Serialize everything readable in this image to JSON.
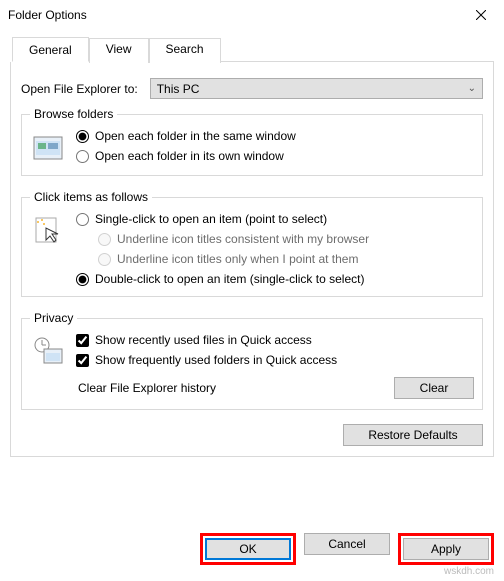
{
  "title": "Folder Options",
  "tabs": {
    "general": "General",
    "view": "View",
    "search": "Search"
  },
  "openExplorer": {
    "label": "Open File Explorer to:",
    "value": "This PC"
  },
  "browse": {
    "legend": "Browse folders",
    "same": "Open each folder in the same window",
    "own": "Open each folder in its own window"
  },
  "click": {
    "legend": "Click items as follows",
    "single": "Single-click to open an item (point to select)",
    "uBrowser": "Underline icon titles consistent with my browser",
    "uPoint": "Underline icon titles only when I point at them",
    "double": "Double-click to open an item (single-click to select)"
  },
  "privacy": {
    "legend": "Privacy",
    "recent": "Show recently used files in Quick access",
    "frequent": "Show frequently used folders in Quick access",
    "clearLabel": "Clear File Explorer history",
    "clearBtn": "Clear"
  },
  "restore": "Restore Defaults",
  "buttons": {
    "ok": "OK",
    "cancel": "Cancel",
    "apply": "Apply"
  },
  "watermark": "wskdh.com"
}
